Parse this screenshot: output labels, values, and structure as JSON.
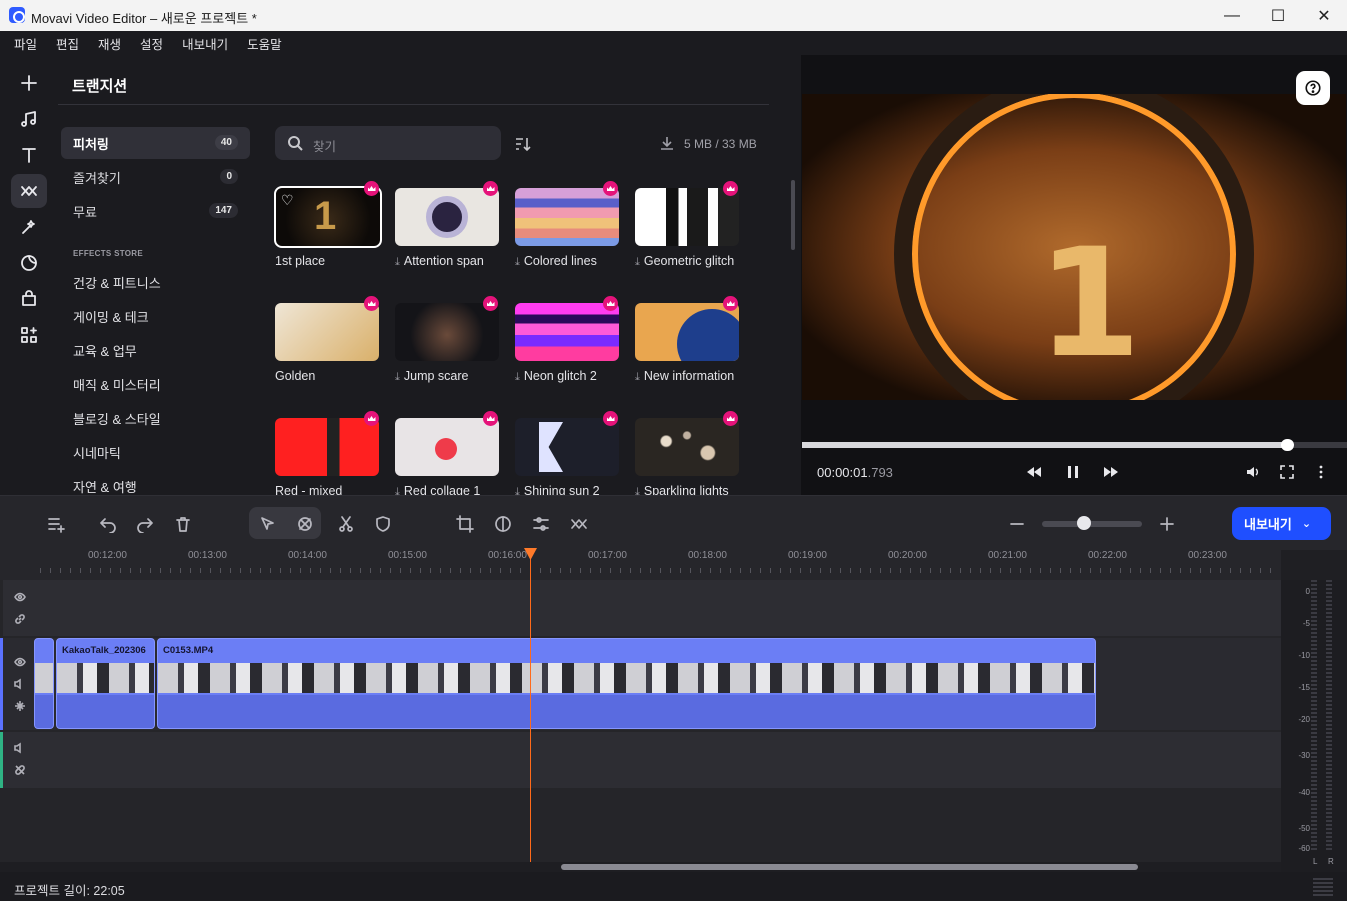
{
  "window": {
    "title": "Movavi Video Editor – 새로운 프로젝트 *"
  },
  "menu": [
    "파일",
    "편집",
    "재생",
    "설정",
    "내보내기",
    "도움말"
  ],
  "panel": {
    "title": "트랜지션",
    "categories": [
      {
        "label": "피처링",
        "count": "40"
      },
      {
        "label": "즐겨찾기",
        "count": "0"
      },
      {
        "label": "무료",
        "count": "147"
      }
    ],
    "store_label": "EFFECTS STORE",
    "store_items": [
      "건강 & 피트니스",
      "게이밍 & 테크",
      "교육 & 업무",
      "매직 & 미스터리",
      "블로깅 & 스타일",
      "시네마틱",
      "자연 & 여행"
    ],
    "search_placeholder": "찾기",
    "storage": "5 MB / 33 MB",
    "transitions": [
      {
        "label": "1st place",
        "downloaded": true
      },
      {
        "label": "Attention span",
        "downloaded": false
      },
      {
        "label": "Colored lines",
        "downloaded": false
      },
      {
        "label": "Geometric glitch",
        "downloaded": false
      },
      {
        "label": "Golden",
        "downloaded": true
      },
      {
        "label": "Jump scare",
        "downloaded": false
      },
      {
        "label": "Neon glitch 2",
        "downloaded": false
      },
      {
        "label": "New information",
        "downloaded": false
      },
      {
        "label": "Red - mixed",
        "downloaded": true
      },
      {
        "label": "Red collage 1",
        "downloaded": false
      },
      {
        "label": "Shining sun 2",
        "downloaded": false
      },
      {
        "label": "Sparkling lights",
        "downloaded": false
      }
    ]
  },
  "player": {
    "time_main": "00:00:01",
    "time_ms": ".793",
    "progress": 0.89
  },
  "toolbar": {
    "export_label": "내보내기"
  },
  "timeline": {
    "ticks": [
      "00:12:00",
      "00:13:00",
      "00:14:00",
      "00:15:00",
      "00:16:00",
      "00:17:00",
      "00:18:00",
      "00:19:00",
      "00:20:00",
      "00:21:00",
      "00:22:00",
      "00:23:00"
    ],
    "clips": [
      {
        "name": "KakaoTalk_202306"
      },
      {
        "name": "C0153.MP4"
      }
    ]
  },
  "meter": {
    "db_labels": [
      "0",
      "-5",
      "-10",
      "-15",
      "-20",
      "-30",
      "-40",
      "-50",
      "-60"
    ],
    "left": "L",
    "right": "R"
  },
  "status": {
    "project_length": "프로젝트 길이: 22:05"
  }
}
